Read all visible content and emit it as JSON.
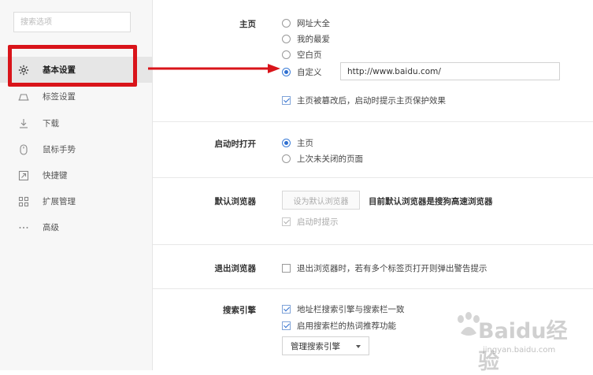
{
  "sidebar": {
    "search_placeholder": "搜索选项",
    "items": [
      {
        "label": "基本设置",
        "icon": "gear-icon",
        "active": true
      },
      {
        "label": "标签设置",
        "icon": "tab-icon",
        "active": false
      },
      {
        "label": "下载",
        "icon": "download-icon",
        "active": false
      },
      {
        "label": "鼠标手势",
        "icon": "mouse-icon",
        "active": false
      },
      {
        "label": "快捷键",
        "icon": "shortcut-icon",
        "active": false
      },
      {
        "label": "扩展管理",
        "icon": "grid-icon",
        "active": false
      },
      {
        "label": "高级",
        "icon": "more-icon",
        "active": false
      }
    ]
  },
  "settings": {
    "homepage": {
      "label": "主页",
      "options": [
        "网址大全",
        "我的最爱",
        "空白页",
        "自定义"
      ],
      "selected": "自定义",
      "custom_url": "http://www.baidu.com/",
      "protect_label": "主页被篡改后，启动时提示主页保护效果",
      "protect_checked": true
    },
    "startup": {
      "label": "启动时打开",
      "options": [
        "主页",
        "上次未关闭的页面"
      ],
      "selected": "主页"
    },
    "default_browser": {
      "label": "默认浏览器",
      "button_label": "设为默认浏览器",
      "status": "目前默认浏览器是搜狗高速浏览器",
      "prompt_label": "启动时提示",
      "prompt_checked": true
    },
    "exit_browser": {
      "label": "退出浏览器",
      "warn_label": "退出浏览器时，若有多个标签页打开则弹出警告提示",
      "warn_checked": false
    },
    "search_engine": {
      "label": "搜索引擎",
      "sync_label": "地址栏搜索引擎与搜索栏一致",
      "sync_checked": true,
      "hot_label": "启用搜索栏的热词推荐功能",
      "hot_checked": true,
      "manage_label": "管理搜索引擎"
    }
  },
  "colors": {
    "highlight": "#d9141a",
    "accent": "#2f6fd0"
  },
  "watermark": {
    "brand": "Baidu经验",
    "url": "jingyan.baidu.com"
  }
}
